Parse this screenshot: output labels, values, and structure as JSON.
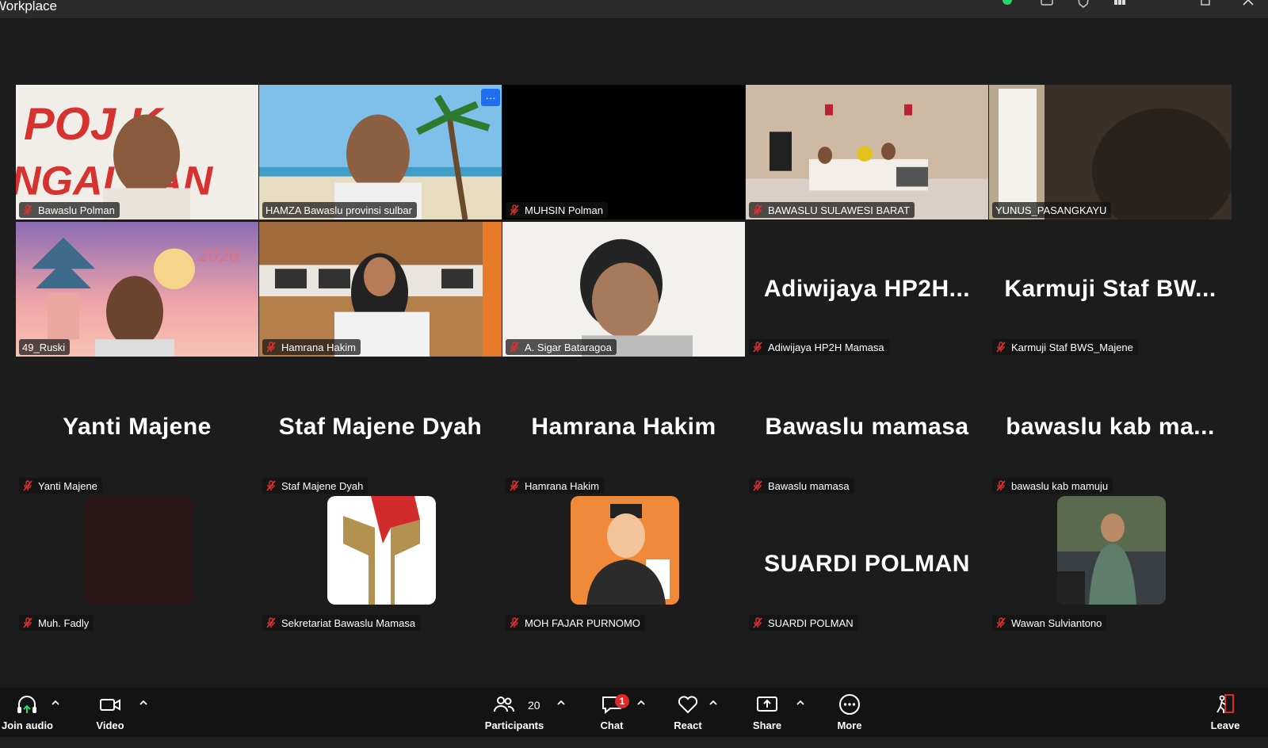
{
  "window": {
    "app_title": "Workplace"
  },
  "tiles": [
    {
      "name": "Bawaslu Polman",
      "scene": "pojok",
      "big": ""
    },
    {
      "name": "HAMZA Bawaslu provinsi sulbar",
      "scene": "beach",
      "big": ""
    },
    {
      "name": "MUHSIN Polman",
      "scene": "black",
      "big": ""
    },
    {
      "name": "BAWASLU SULAWESI BARAT",
      "scene": "office",
      "big": ""
    },
    {
      "name": "YUNUS_PASANGKAYU",
      "scene": "room",
      "big": ""
    },
    {
      "name": "49_Ruski",
      "scene": "temple",
      "big": ""
    },
    {
      "name": "Hamrana Hakim",
      "scene": "woman",
      "big": ""
    },
    {
      "name": "A. Sigar Bataragoa",
      "scene": "man-white",
      "big": ""
    },
    {
      "name": "Adiwijaya HP2H Mamasa",
      "scene": "none",
      "big": "Adiwijaya HP2H..."
    },
    {
      "name": "Karmuji Staf BWS_Majene",
      "scene": "none",
      "big": "Karmuji Staf BW..."
    },
    {
      "name": "Yanti Majene",
      "scene": "none",
      "big": "Yanti Majene"
    },
    {
      "name": "Staf Majene Dyah",
      "scene": "none",
      "big": "Staf Majene Dyah"
    },
    {
      "name": "Hamrana Hakim",
      "scene": "none",
      "big": "Hamrana Hakim"
    },
    {
      "name": "Bawaslu mamasa",
      "scene": "none",
      "big": "Bawaslu mamasa"
    },
    {
      "name": "bawaslu kab mamuju",
      "scene": "none",
      "big": "bawaslu kab ma..."
    },
    {
      "name": "Muh. Fadly",
      "scene": "avatar-dark",
      "big": ""
    },
    {
      "name": "Sekretariat Bawaslu Mamasa",
      "scene": "avatar-logo",
      "big": ""
    },
    {
      "name": "MOH FAJAR PURNOMO",
      "scene": "avatar-cartoon",
      "big": ""
    },
    {
      "name": "SUARDI POLMAN",
      "scene": "none",
      "big": "SUARDI POLMAN"
    },
    {
      "name": "Wawan Sulviantono",
      "scene": "avatar-photo",
      "big": ""
    }
  ],
  "toolbar": {
    "join_audio": "Join audio",
    "video": "Video",
    "participants": "Participants",
    "participants_count": "20",
    "chat": "Chat",
    "chat_badge": "1",
    "react": "React",
    "share": "Share",
    "more": "More",
    "leave": "Leave"
  },
  "colors": {
    "active_speaker": "#23d96a",
    "mic_off": "#e03030",
    "badge": "#e02828",
    "more_menu": "#1e6ef0"
  }
}
